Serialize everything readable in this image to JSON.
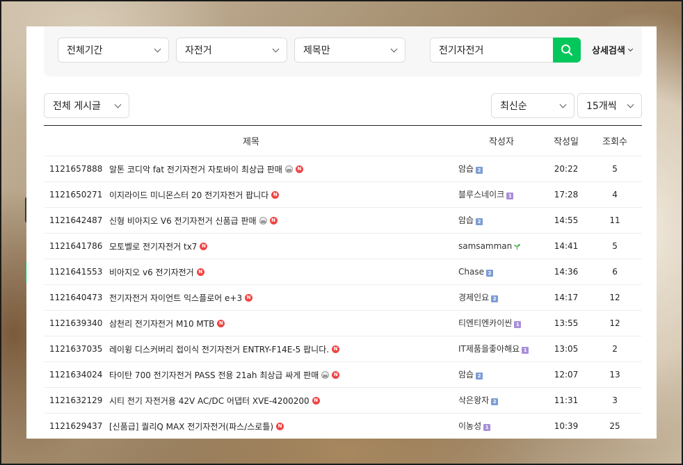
{
  "search": {
    "period": "전체기간",
    "board": "자전거",
    "scope": "제목만",
    "query": "전기자전거",
    "advanced_label": "상세검색"
  },
  "filters": {
    "post_type": "전체 게시글",
    "sort": "최신순",
    "per_page": "15개씩"
  },
  "table": {
    "headers": {
      "title": "제목",
      "author": "작성자",
      "date": "작성일",
      "views": "조회수"
    },
    "rows": [
      {
        "id": "1121657888",
        "title": "알톤 코디악 fat 전기자전거 자토바이 최상급 판매",
        "has_image": true,
        "new": true,
        "author": "암습",
        "level": "2",
        "date": "20:22",
        "views": "5"
      },
      {
        "id": "1121650271",
        "title": "이지라이드 미니몬스터 20 전기자전거 팝니다",
        "has_image": false,
        "new": true,
        "author": "블루스네이크",
        "level": "1",
        "date": "17:28",
        "views": "4"
      },
      {
        "id": "1121642487",
        "title": "신형 비아지오 V6 전기자전거 신품급 판매",
        "has_image": true,
        "new": true,
        "author": "암습",
        "level": "2",
        "date": "14:55",
        "views": "11"
      },
      {
        "id": "1121641786",
        "title": "모토벨로 전기자전거 tx7",
        "has_image": false,
        "new": true,
        "author": "samsamman",
        "level": "sprout",
        "date": "14:41",
        "views": "5"
      },
      {
        "id": "1121641553",
        "title": "비아지오 v6 전기자전거",
        "has_image": false,
        "new": true,
        "author": "Chase",
        "level": "2",
        "date": "14:36",
        "views": "6"
      },
      {
        "id": "1121640473",
        "title": "전기자전거 자이언트 익스플로어 e+3",
        "has_image": false,
        "new": true,
        "author": "경제인요",
        "level": "2",
        "date": "14:17",
        "views": "12"
      },
      {
        "id": "1121639340",
        "title": "삼천리 전기자전거 M10 MTB",
        "has_image": false,
        "new": true,
        "author": "티엔티엔카이씬",
        "level": "1",
        "date": "13:55",
        "views": "12"
      },
      {
        "id": "1121637035",
        "title": "레이윙 디스커버리 접이식 전기자전거 ENTRY-F14E-5 팝니다.",
        "has_image": false,
        "new": true,
        "author": "IT제품을좋아해요",
        "level": "1",
        "date": "13:05",
        "views": "2"
      },
      {
        "id": "1121634024",
        "title": "타이탄 700 전기자전거 PASS 전용 21ah 최상급 싸게 판매",
        "has_image": true,
        "new": true,
        "author": "암습",
        "level": "2",
        "date": "12:07",
        "views": "13"
      },
      {
        "id": "1121632129",
        "title": "시티 전기 자전거용 42V AC/DC 어댑터 XVE-4200200",
        "has_image": false,
        "new": true,
        "author": "삭은왕자",
        "level": "2",
        "date": "11:31",
        "views": "3"
      },
      {
        "id": "1121629437",
        "title": "[신품급] 퀄리Q MAX 전기자전거(파스/스로틀)",
        "has_image": false,
        "new": true,
        "author": "이농성",
        "level": "1",
        "date": "10:39",
        "views": "25"
      }
    ]
  },
  "colors": {
    "accent": "#03c75a",
    "new_badge": "#ef4444",
    "level2": "#7b9cd6",
    "level1": "#a88fd8"
  }
}
